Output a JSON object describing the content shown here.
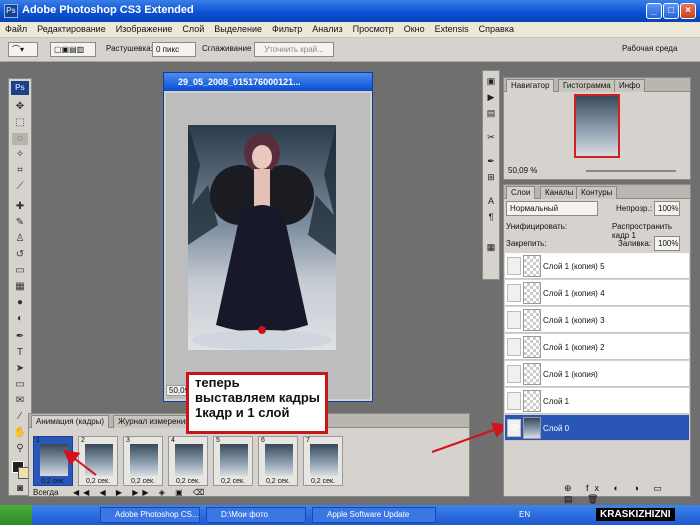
{
  "window": {
    "title": "Adobe Photoshop CS3 Extended",
    "logo": "Ps"
  },
  "menu": [
    "Файл",
    "Редактирование",
    "Изображение",
    "Слой",
    "Выделение",
    "Фильтр",
    "Анализ",
    "Просмотр",
    "Окно",
    "Extensis",
    "Справка"
  ],
  "options": {
    "feather_label": "Растушевка:",
    "feather_value": "0 пикс",
    "smooth_label": "Сглаживание",
    "refine_button": "Уточнить край...",
    "workspace_label": "Рабочая среда"
  },
  "document": {
    "title": "29_05_2008_015176000121...",
    "zoom": "50,09 %"
  },
  "annotation": {
    "line1": "теперь",
    "line2": "выставляем кадры",
    "line3": "1кадр и 1 слой"
  },
  "animation": {
    "tab_active": "Анимация (кадры)",
    "tab_other": "Журнал измерений",
    "loop": "Всегда",
    "frames": [
      {
        "n": "1",
        "d": "0,2 сек."
      },
      {
        "n": "2",
        "d": "0,2 сек."
      },
      {
        "n": "3",
        "d": "0,2 сек."
      },
      {
        "n": "4",
        "d": "0,2 сек."
      },
      {
        "n": "5",
        "d": "0,2 сек."
      },
      {
        "n": "6",
        "d": "0,2 сек."
      },
      {
        "n": "7",
        "d": "0,2 сек."
      }
    ]
  },
  "navigator": {
    "tabs": [
      "Навигатор",
      "Гистограмма",
      "Инфо"
    ],
    "zoom": "50,09 %"
  },
  "layers": {
    "tabs": [
      "Слои",
      "Каналы",
      "Контуры"
    ],
    "blend": "Нормальный",
    "opacity_label": "Непрозр.:",
    "opacity": "100%",
    "unify_label": "Унифицировать:",
    "propagate": "Распространить кадр 1",
    "lock_label": "Закрепить:",
    "fill_label": "Заливка:",
    "fill": "100%",
    "items": [
      "Слой 1 (копия) 5",
      "Слой 1 (копия) 4",
      "Слой 1 (копия) 3",
      "Слой 1 (копия) 2",
      "Слой 1 (копия)",
      "Слой 1",
      "Слой 0"
    ]
  },
  "taskbar": {
    "start": "",
    "items": [
      "Adobe Photoshop CS...",
      "D:\\Мои фото",
      "Apple Software Update"
    ],
    "lang": "EN",
    "watermark": "KRASKIZHIZNI"
  }
}
